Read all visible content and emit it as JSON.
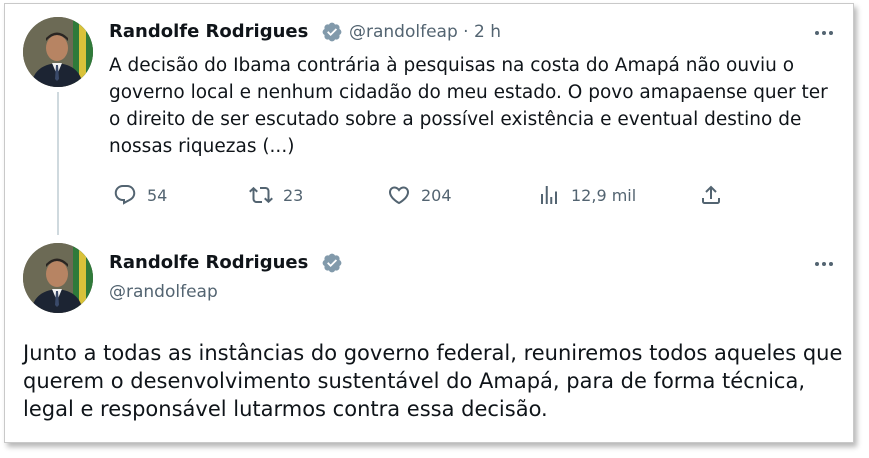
{
  "tweet1": {
    "author_name": "Randolfe Rodrigues",
    "handle": "@randolfeap",
    "time_separator": " · ",
    "time": "2 h",
    "text": "A decisão do Ibama contrária à pesquisas na costa do Amapá não ouviu o governo local e nenhum cidadão do meu estado. O povo amapaense quer ter o direito de ser escutado sobre a possível existência e eventual destino de nossas riquezas (...)",
    "replies": "54",
    "retweets": "23",
    "likes": "204",
    "views": "12,9 mil"
  },
  "tweet2": {
    "author_name": "Randolfe Rodrigues",
    "handle": "@randolfeap",
    "text": "Junto a todas as instâncias do governo federal, reuniremos todos aqueles que querem o desenvolvimento sustentável do Amapá, para de forma técnica, legal e responsável lutarmos contra essa decisão."
  },
  "colors": {
    "verified_badge": "#829aab",
    "secondary_text": "#536471",
    "primary_text": "#0f1419",
    "thread_line": "#cfd9de"
  },
  "icons": {
    "verified": "verified-badge-icon",
    "more": "more-options-icon",
    "reply": "reply-icon",
    "retweet": "retweet-icon",
    "like": "heart-icon",
    "views": "views-chart-icon",
    "share": "share-icon"
  }
}
